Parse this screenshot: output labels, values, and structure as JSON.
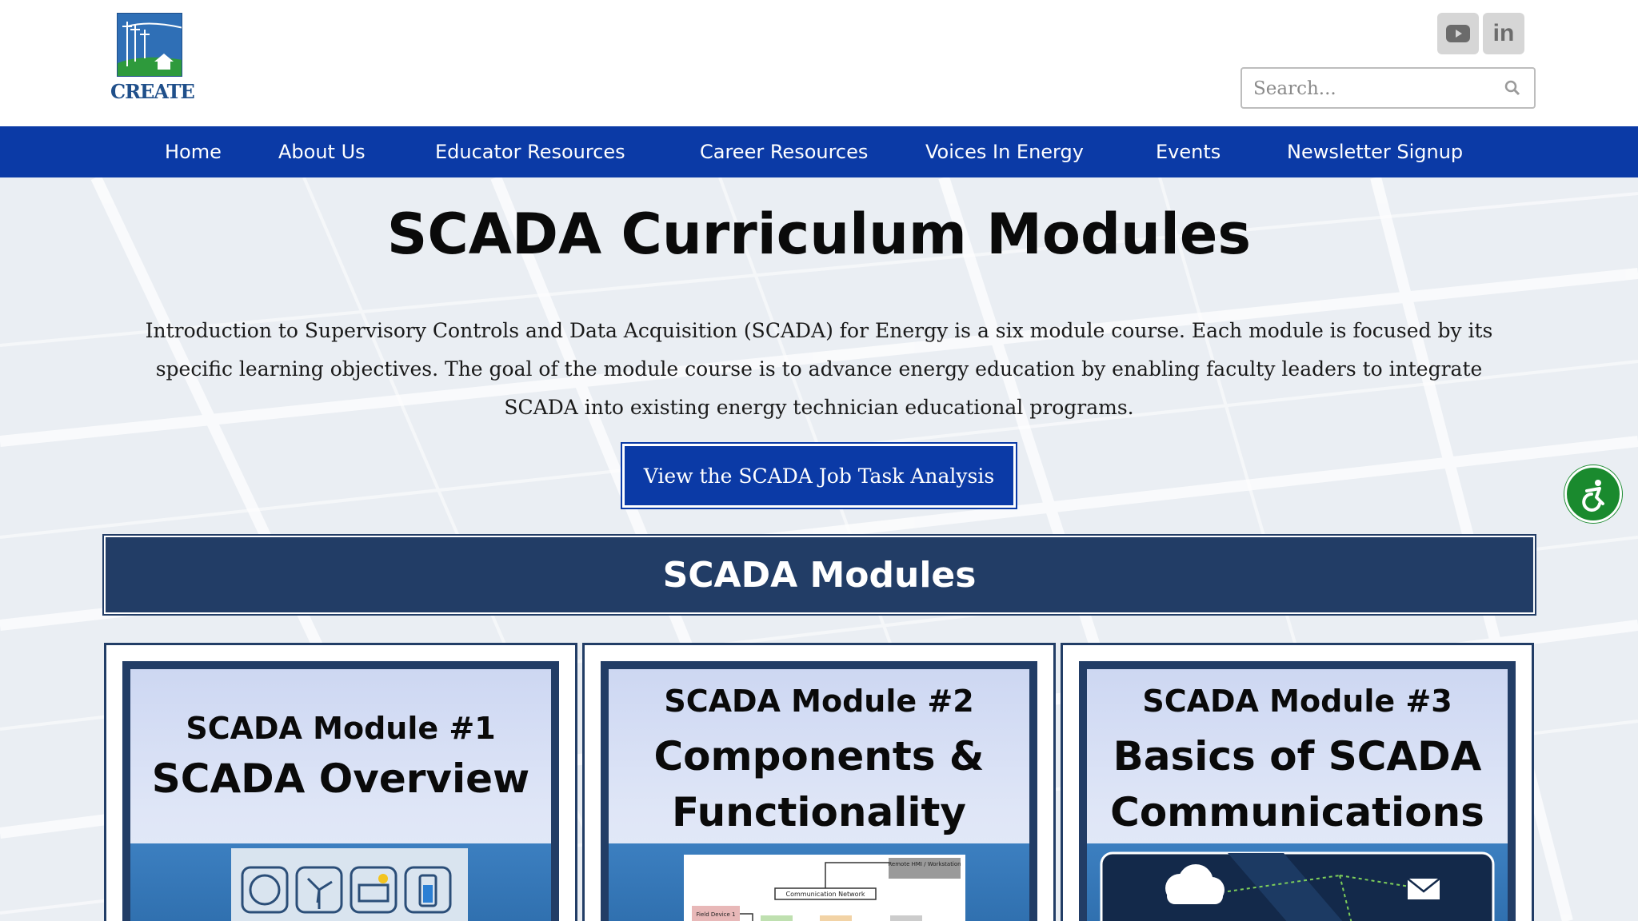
{
  "header": {
    "logo_text": "CREATE",
    "social": [
      {
        "name": "youtube",
        "icon": "youtube-icon"
      },
      {
        "name": "linkedin",
        "icon": "linkedin-icon",
        "glyph": "in"
      }
    ],
    "search": {
      "placeholder": "Search...",
      "value": ""
    }
  },
  "nav": {
    "items": [
      {
        "label": "Home"
      },
      {
        "label": "About Us"
      },
      {
        "label": "Educator Resources"
      },
      {
        "label": "Career Resources"
      },
      {
        "label": "Voices In Energy"
      },
      {
        "label": "Events"
      },
      {
        "label": "Newsletter Signup"
      }
    ]
  },
  "main": {
    "title": "SCADA Curriculum Modules",
    "intro": "Introduction to Supervisory Controls and Data Acquisition (SCADA) for Energy is a six module course.  Each module is focused by its specific learning objectives. The goal of the module course is to advance energy education by enabling faculty leaders to integrate SCADA into existing energy technician educational programs.",
    "cta_label": "View the SCADA Job Task Analysis",
    "section_title": "SCADA Modules",
    "modules": [
      {
        "number": "SCADA Module #1",
        "title_lines": [
          "SCADA Overview"
        ]
      },
      {
        "number": "SCADA Module #2",
        "title_lines": [
          "Components &",
          "Functionality"
        ]
      },
      {
        "number": "SCADA Module #3",
        "title_lines": [
          "Basics of SCADA",
          "Communications"
        ]
      }
    ],
    "thumb2": {
      "network_label": "Communication Network",
      "hmi_label": "Remote HMI / Workstation",
      "device_label": "Field Device 1"
    }
  },
  "colors": {
    "nav_bg": "#0b3aa6",
    "section_bg": "#223d66",
    "accessibility_green": "#1a8a2e"
  }
}
